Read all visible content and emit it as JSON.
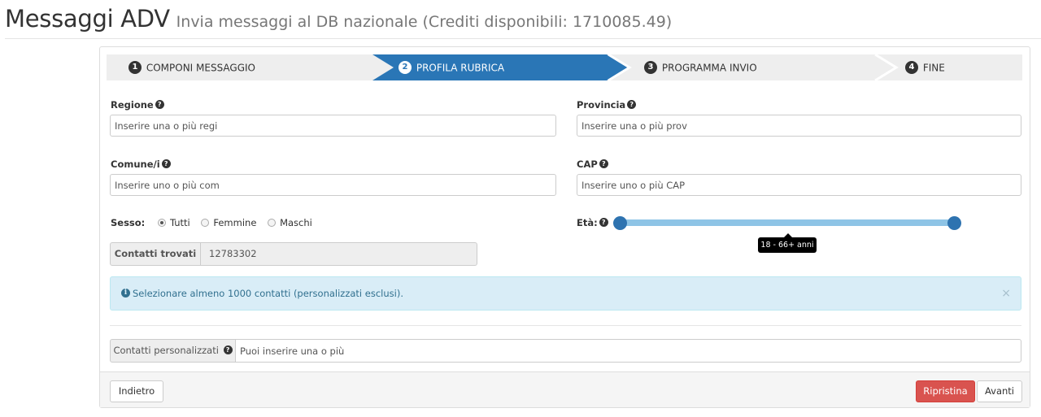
{
  "header": {
    "title": "Messaggi ADV",
    "subtitle": "Invia messaggi al DB nazionale (Crediti disponibili: 1710085.49)"
  },
  "wizard": {
    "steps": [
      {
        "num": "1",
        "label": "COMPONI MESSAGGIO",
        "active": false
      },
      {
        "num": "2",
        "label": "PROFILA RUBRICA",
        "active": true
      },
      {
        "num": "3",
        "label": "PROGRAMMA INVIO",
        "active": false
      },
      {
        "num": "4",
        "label": "FINE",
        "active": false
      }
    ],
    "active_color": "#2a76b6",
    "inactive_color": "#eeeeee"
  },
  "form": {
    "regione": {
      "label": "Regione",
      "placeholder": "Inserire una o più regi"
    },
    "provincia": {
      "label": "Provincia",
      "placeholder": "Inserire una o più prov"
    },
    "comune": {
      "label": "Comune/i",
      "placeholder": "Inserire uno o più com"
    },
    "cap": {
      "label": "CAP",
      "placeholder": "Inserire uno o più CAP"
    },
    "sesso": {
      "label": "Sesso:",
      "options": [
        "Tutti",
        "Femmine",
        "Maschi"
      ],
      "selected": "Tutti"
    },
    "eta": {
      "label": "Età:",
      "tooltip": "18 - 66+ anni",
      "min": 18,
      "max": "66+",
      "range_fraction": [
        0,
        1
      ]
    },
    "contatti_trovati": {
      "label": "Contatti trovati",
      "value": "12783302"
    }
  },
  "alert": {
    "text": "Selezionare almeno 1000 contatti (personalizzati esclusi).",
    "close": "×",
    "bg_color": "#d9edf7"
  },
  "custom": {
    "label": "Contatti personalizzati",
    "placeholder": "Puoi inserire una o più"
  },
  "footer": {
    "back_label": "Indietro",
    "reset_label": "Ripristina",
    "next_label": "Avanti",
    "reset_color": "#d9534f"
  },
  "icons": {
    "help": "question-circle-icon",
    "info": "info-circle-icon"
  }
}
